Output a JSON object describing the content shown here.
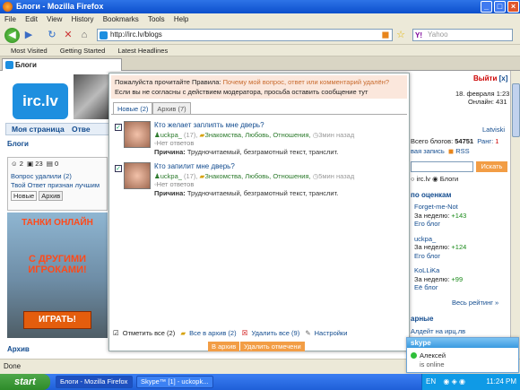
{
  "window": {
    "title": "Блоги - Mozilla Firefox"
  },
  "menubar": [
    "File",
    "Edit",
    "View",
    "History",
    "Bookmarks",
    "Tools",
    "Help"
  ],
  "nav": {
    "url": "http://irc.lv/blogs",
    "search_placeholder": "Yahoo"
  },
  "bookmarks": [
    "Most Visited",
    "Getting Started",
    "Latest Headlines"
  ],
  "tab": {
    "label": "Блоги"
  },
  "page": {
    "logo": "irc.lv",
    "nav_tabs": [
      "Моя страница",
      "Отве"
    ],
    "blogs_heading": "Блоги",
    "left_counts": [
      "2",
      "23",
      "0"
    ],
    "left_lines": [
      "Вопрос удалили (2)",
      "Твой Ответ признан лучшим"
    ],
    "left_tabs": [
      "Новые",
      "Архив"
    ],
    "banner": {
      "top": "ТАНКИ ОНЛАЙН",
      "middle": "С ДРУГИМИ ИГРОКАМИ!",
      "button": "ИГРАТЬ!"
    },
    "archive_heading": "Архив",
    "right": {
      "exit": "Выйти",
      "x": "[x]",
      "date": "18. февраля 1:23",
      "online": "Онлайн: 431",
      "lang": "Latviski",
      "total_blogs_label": "Всего блогов:",
      "total_blogs": "54751",
      "rank_label": "Ранг:",
      "rank_value": "1",
      "new_entry": "вая запись",
      "rss": "RSS",
      "search_button": "Искать",
      "radio_irc": "irc.lv",
      "radio_blogs": "Блоги",
      "by_rating": "по оценкам",
      "forget": "Forget-me-Not",
      "week_label": "За неделю:",
      "week1": "+143",
      "his_blog": "Его блог",
      "user2": "uckpa_",
      "week2": "+124",
      "user3": "KoLLiKa",
      "week3": "+99",
      "her_blog": "Её блог",
      "all_rating": "Весь рейтинг »",
      "headline1": "арные",
      "headline2": "Алдейт на ирц.лв"
    }
  },
  "modal": {
    "notice_prefix": "Пожалуйста прочитайте Правила:",
    "notice_link": "Почему мой вопрос, ответ или комментарий удалён?",
    "notice_line2": "Если вы не согласны с действием модератора, просьба оставить сообщение тут",
    "tabs": [
      "Новые (2)",
      "Архив (7)"
    ],
    "posts": [
      {
        "title": "Кто желает заплипть мне дверь?",
        "user": "uckpa_",
        "age": "(17),",
        "cat": "Знакомства, Любовь, Отношения,",
        "time": "3мин назад",
        "note": "Нет ответов",
        "reason_label": "Причина:",
        "reason": "Трудночитаемый, безграмотный текст, транслит."
      },
      {
        "title": "Кто запилит мне дверь?",
        "user": "uckpa_",
        "age": "(17),",
        "cat": "Знакомства, Любовь, Отношения,",
        "time": "5мин назад",
        "note": "Нет ответов",
        "reason_label": "Причина:",
        "reason": "Трудночитаемый, безграмотный текст, транслит."
      }
    ],
    "footer": {
      "mark_all": "Отметить все (2)",
      "all_archive": "Все в архив (2)",
      "delete_all": "Удалить все (9)",
      "settings": "Настройки"
    },
    "buttons": {
      "to_archive": "В архив",
      "delete_marked": "Удалить отмечени"
    }
  },
  "status": {
    "text": "Done"
  },
  "taskbar": {
    "start": "start",
    "tasks": [
      "Блоги - Mozilla Firefox",
      "Skype™ [1] - uckopk..."
    ],
    "lang": "EN",
    "time": "11:24 PM"
  },
  "skype_popup": {
    "header": "skype",
    "name": "Алексей",
    "state": "is online"
  }
}
